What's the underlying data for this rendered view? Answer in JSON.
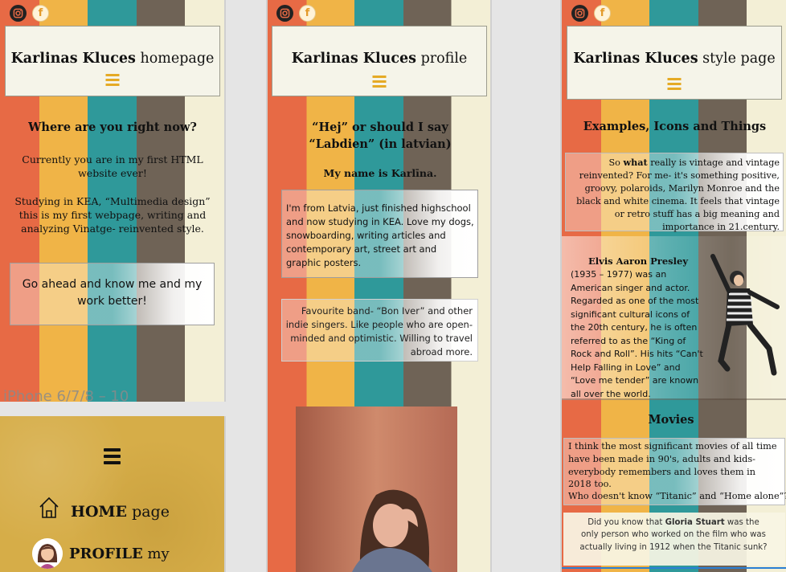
{
  "social": {
    "instagram_icon": "instagram-icon",
    "facebook_icon": "facebook-icon",
    "facebook_glyph": "f"
  },
  "home": {
    "title_bold": "Karlinas Kluces",
    "title_rest": " homepage",
    "heading": "Where are you right now?",
    "p1": "Currently you are in my first HTML website ever!",
    "p2": "Studying in KEA, “Multimedia design” this is my first webpage, writing and analyzing Vinatge- reinvented style.",
    "cta": "Go ahead and know me and my work better!",
    "artboard_label": "iPhone 6/7/8 – 10"
  },
  "menu": {
    "home_bold": "HOME",
    "home_rest": " page",
    "profile_bold": "PROFILE",
    "profile_rest": " my"
  },
  "profile": {
    "title_bold": "Karlinas Kluces",
    "title_rest": " profile",
    "heading": "“Hej” or should I say “Labdien” (in latvian)",
    "name_line": "My name is Karlīna.",
    "box1": "I'm from Latvia, just finished highschool and now studying in KEA. Love my dogs, snowboarding, writing articles and contemporary art, street art and graphic posters.",
    "box2": "Favourite band- “Bon Iver” and other indie singers. Like people who are open-minded and optimistic. Willing to travel abroad more."
  },
  "style": {
    "title_bold": "Karlinas Kluces",
    "title_rest": " style page",
    "heading": "Examples, Icons and Things",
    "intro_pre": "So ",
    "intro_bold": "what",
    "intro_rest": " really is vintage and vintage reinvented? For me- it's something positive, groovy, polaroids, Marilyn Monroe and the black and white cinema. It feels that vintage or retro stuff has a big meaning and importance in 21.century.",
    "elvis_name": "Elvis Aaron Presley",
    "elvis_text": "(1935 – 1977) was an American singer and actor. Regarded as one of the most significant cultural icons of the 20th century, he is often referred to as the “King of Rock and Roll”. His hits “Can't Help Falling in Love” and “Love me tender” are known all over the world.",
    "movies_heading": "Movies",
    "movies_text": "I think the most significant movies of all time have been made in 90's, adults and kids- everybody remembers and loves them in 2018 too.",
    "movies_q": "Who doesn't know “Titanic” and “Home alone”?",
    "titanic_pre": "Did you know that ",
    "titanic_bold": "Gloria Stuart",
    "titanic_rest": " was the only person who worked on the film who was actually living in 1912 when the Titanic sunk?"
  }
}
